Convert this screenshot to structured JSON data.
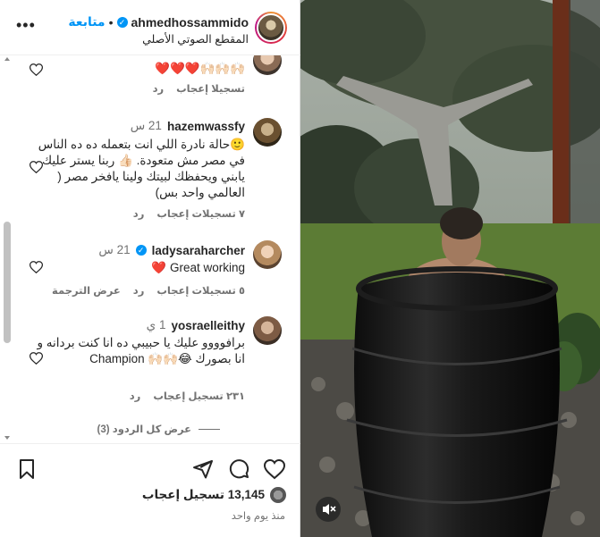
{
  "header": {
    "username": "ahmedhossammido",
    "follow_label": "متابعة",
    "separator": "•",
    "audio_label": "المقطع الصوتي الأصلي",
    "more_label": "•••"
  },
  "comments": [
    {
      "username": "",
      "time": "",
      "text": "🙌🏻🙌🏻🙌🏻❤️❤️❤️",
      "likes_label": "تسجيلا إعجاب",
      "reply_label": "رد",
      "extra_label": ""
    },
    {
      "username": "hazemwassfy",
      "time": "21 س",
      "text": "🙂حالة نادرة اللي انت بتعمله ده ده الناس في مصر مش متعودة. 👍🏻 ربنا يستر عليك يابني ويحفظك لبيتك ولينا يافخر مصر ( العالمي واحد بس)",
      "likes_label": "٧ تسجيلات إعجاب",
      "reply_label": "رد",
      "extra_label": ""
    },
    {
      "username": "ladysaraharcher",
      "time": "21 س",
      "text": "Great working ❤️",
      "likes_label": "٥ تسجيلات إعجاب",
      "reply_label": "رد",
      "extra_label": "عرض الترجمة"
    },
    {
      "username": "yosraelleithy",
      "time": "1 ي",
      "text": "برافوووو عليك يا حبيبي ده انا كنت بردانه و انا بصورك 😂🙌🏻🙌🏻 Champion",
      "likes_label": "٢٣١ تسجيل إعجاب",
      "reply_label": "رد",
      "extra_label": ""
    }
  ],
  "view_replies_label": "عرض كل الردود (3)",
  "actions": {
    "likes_label": "13,145 تسجيل إعجاب",
    "posted_time": "منذ يوم واحد"
  },
  "colors": {
    "accent": "#0095f6",
    "heart": "#d92b2b",
    "muted": "#737373"
  }
}
